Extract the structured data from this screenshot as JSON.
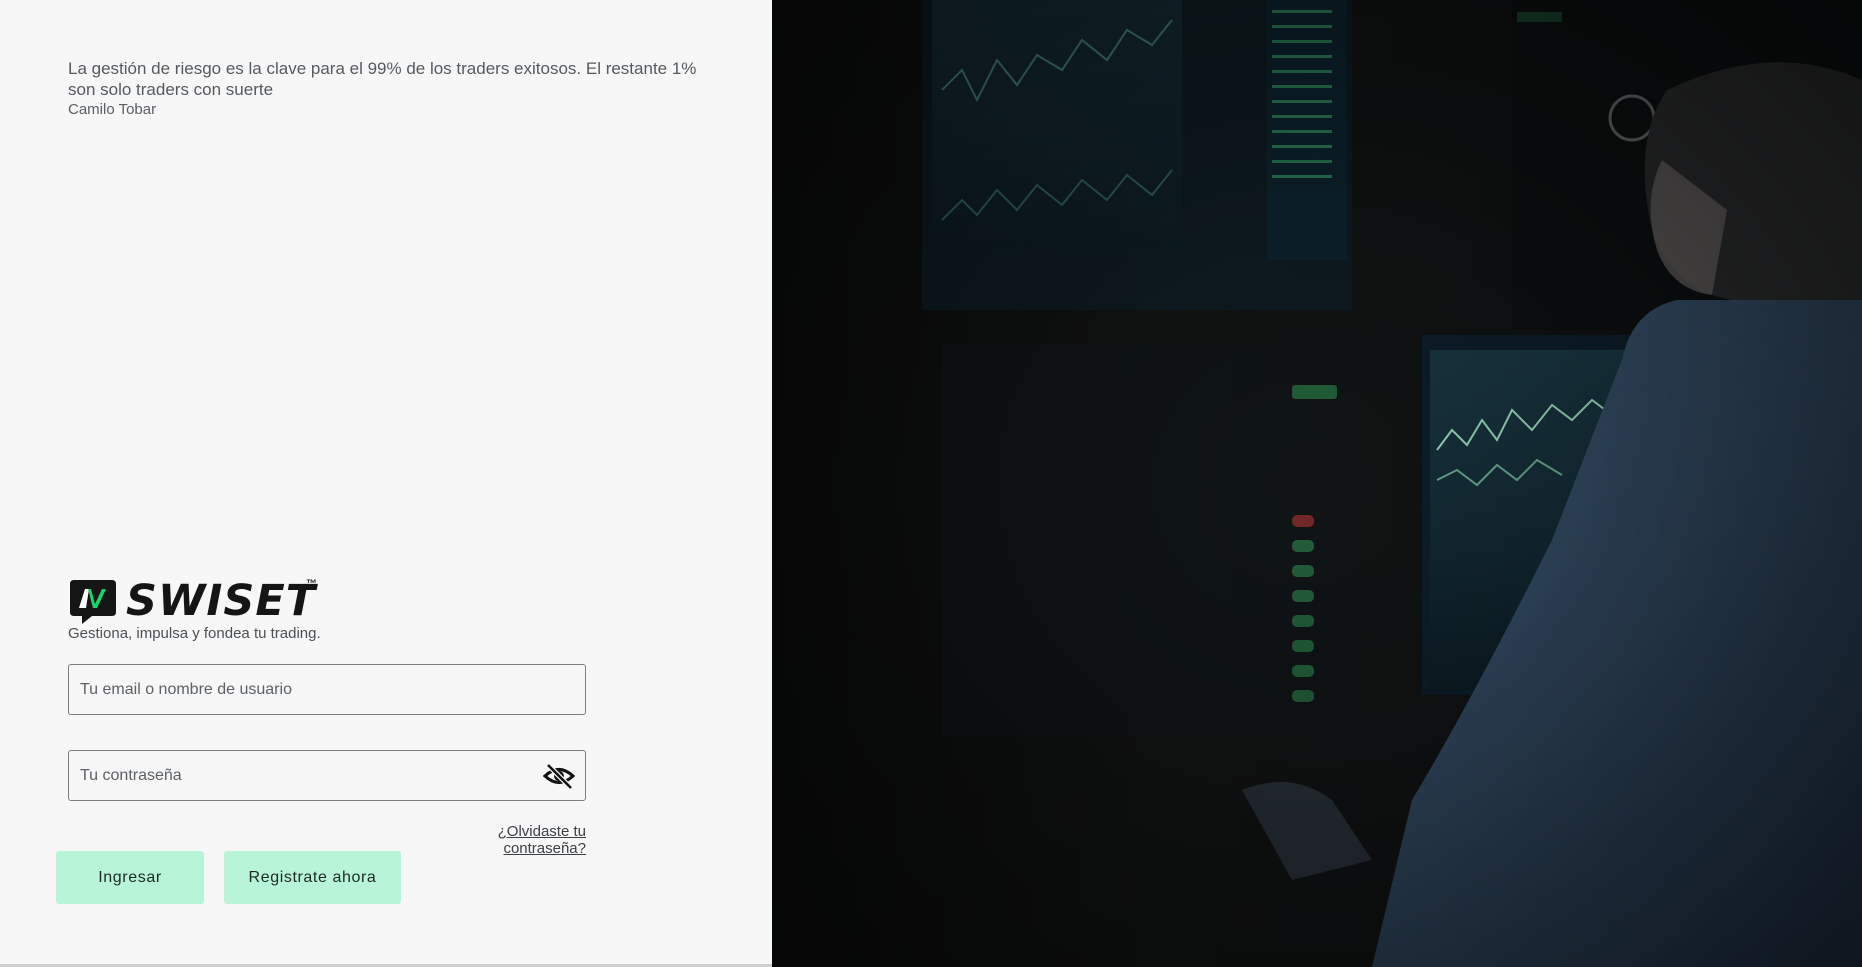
{
  "quote": {
    "text": "La gestión de riesgo es la clave para el 99% de los traders exitosos. El restante 1% son solo traders con suerte",
    "author": "Camilo Tobar"
  },
  "brand": {
    "logo_text": "SWISET",
    "trademark": "™",
    "tagline": "Gestiona, impulsa y fondea tu trading.",
    "accent_color": "#18d46a"
  },
  "login_form": {
    "email_placeholder": "Tu email o nombre de usuario",
    "password_placeholder": "Tu contraseña",
    "forgot_label": "¿Olvidaste tu contraseña?",
    "login_label": "Ingresar",
    "register_label": "Registrate ahora",
    "button_color": "#b8f4d8"
  },
  "icons": {
    "password_toggle": "eye-slash-icon"
  }
}
